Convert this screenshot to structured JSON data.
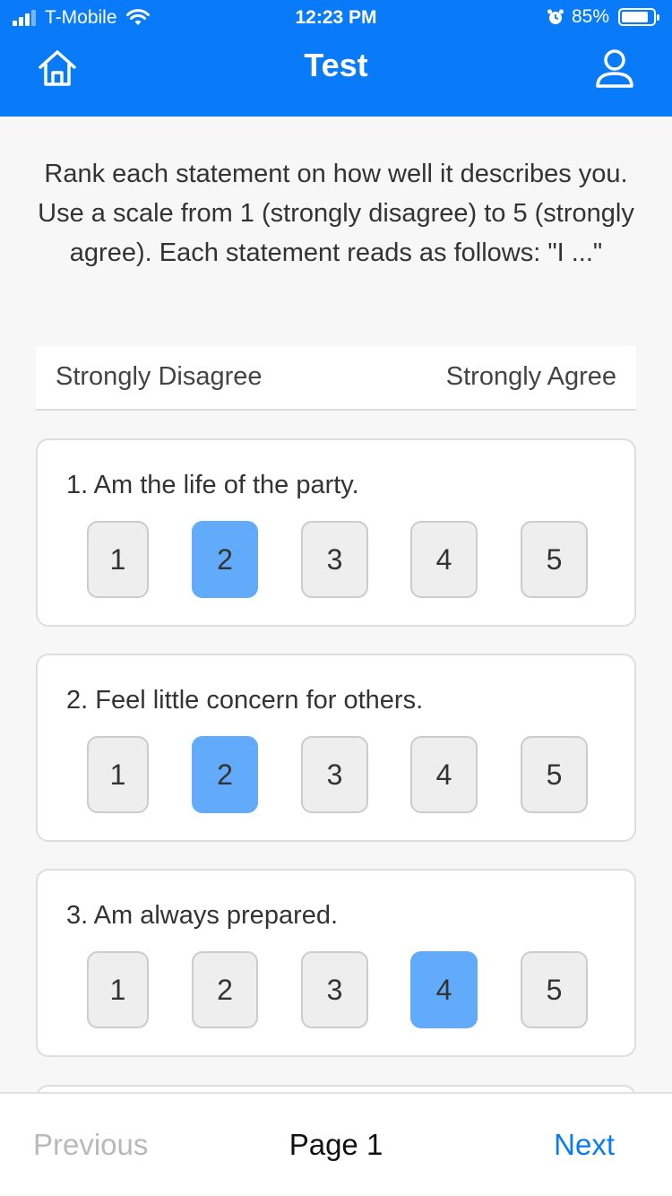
{
  "status_bar": {
    "carrier": "T-Mobile",
    "time": "12:23 PM",
    "battery_percent": "85%",
    "battery_level": 0.85
  },
  "header": {
    "title": "Test",
    "home_icon": "home-icon",
    "user_icon": "user-icon",
    "accent_color": "#0a7bf8"
  },
  "instructions": "Rank each statement on how well it describes you. Use a scale from 1 (strongly disagree) to 5 (strongly agree). Each statement reads as follows: \"I ...\"",
  "scale": {
    "left_label": "Strongly Disagree",
    "right_label": "Strongly Agree"
  },
  "questions": [
    {
      "text": "1. Am the life of the party.",
      "options": [
        "1",
        "2",
        "3",
        "4",
        "5"
      ],
      "selected": "2"
    },
    {
      "text": "2. Feel little concern for others.",
      "options": [
        "1",
        "2",
        "3",
        "4",
        "5"
      ],
      "selected": "2"
    },
    {
      "text": "3. Am always prepared.",
      "options": [
        "1",
        "2",
        "3",
        "4",
        "5"
      ],
      "selected": "4"
    }
  ],
  "footer": {
    "previous_label": "Previous",
    "page_label": "Page 1",
    "next_label": "Next"
  },
  "colors": {
    "selected_option": "#62aafa",
    "disabled_text": "#b9b9b9"
  }
}
